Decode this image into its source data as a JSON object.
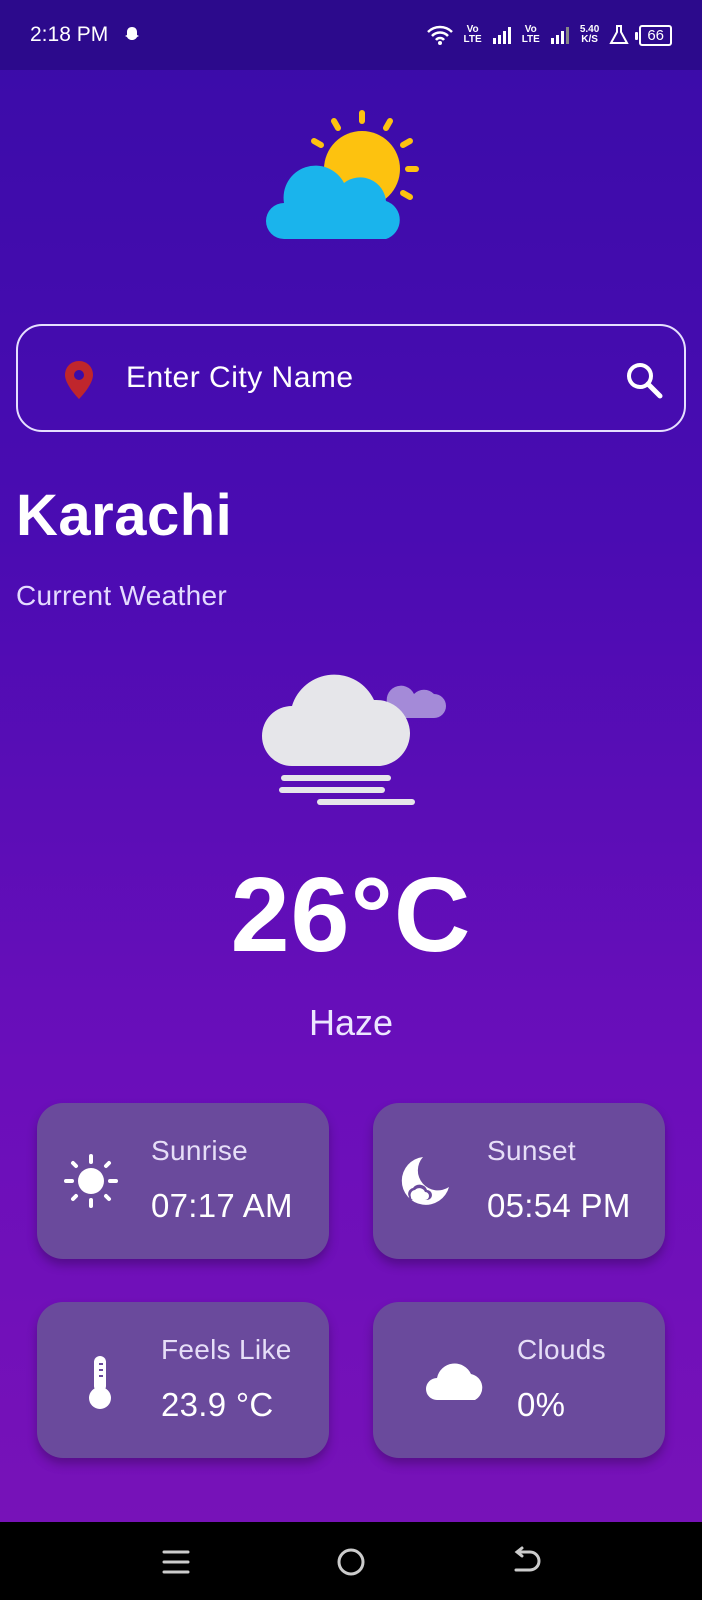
{
  "status_bar": {
    "time": "2:18 PM",
    "vo1": "Vo",
    "lte1": "LTE",
    "vo2": "Vo",
    "lte2": "LTE",
    "speed_value": "5.40",
    "speed_unit": "K/S",
    "battery": "66"
  },
  "search": {
    "placeholder": "Enter City Name"
  },
  "city": "Karachi",
  "subtitle": "Current Weather",
  "temperature": "26°C",
  "condition": "Haze",
  "cards": [
    {
      "label": "Sunrise",
      "value": "07:17 AM",
      "icon": "sun-icon"
    },
    {
      "label": "Sunset",
      "value": "05:54 PM",
      "icon": "moon-icon"
    },
    {
      "label": "Feels Like",
      "value": "23.9 °C",
      "icon": "thermometer-icon"
    },
    {
      "label": "Clouds",
      "value": "0%",
      "icon": "cloud-icon"
    }
  ],
  "colors": {
    "background_top": "#3a0ca8",
    "background_bottom": "#7712b8",
    "card": "#6a4a9c",
    "sun": "#fdc20f",
    "cloud_blue": "#1ab4ec",
    "pin": "#c0262c"
  }
}
